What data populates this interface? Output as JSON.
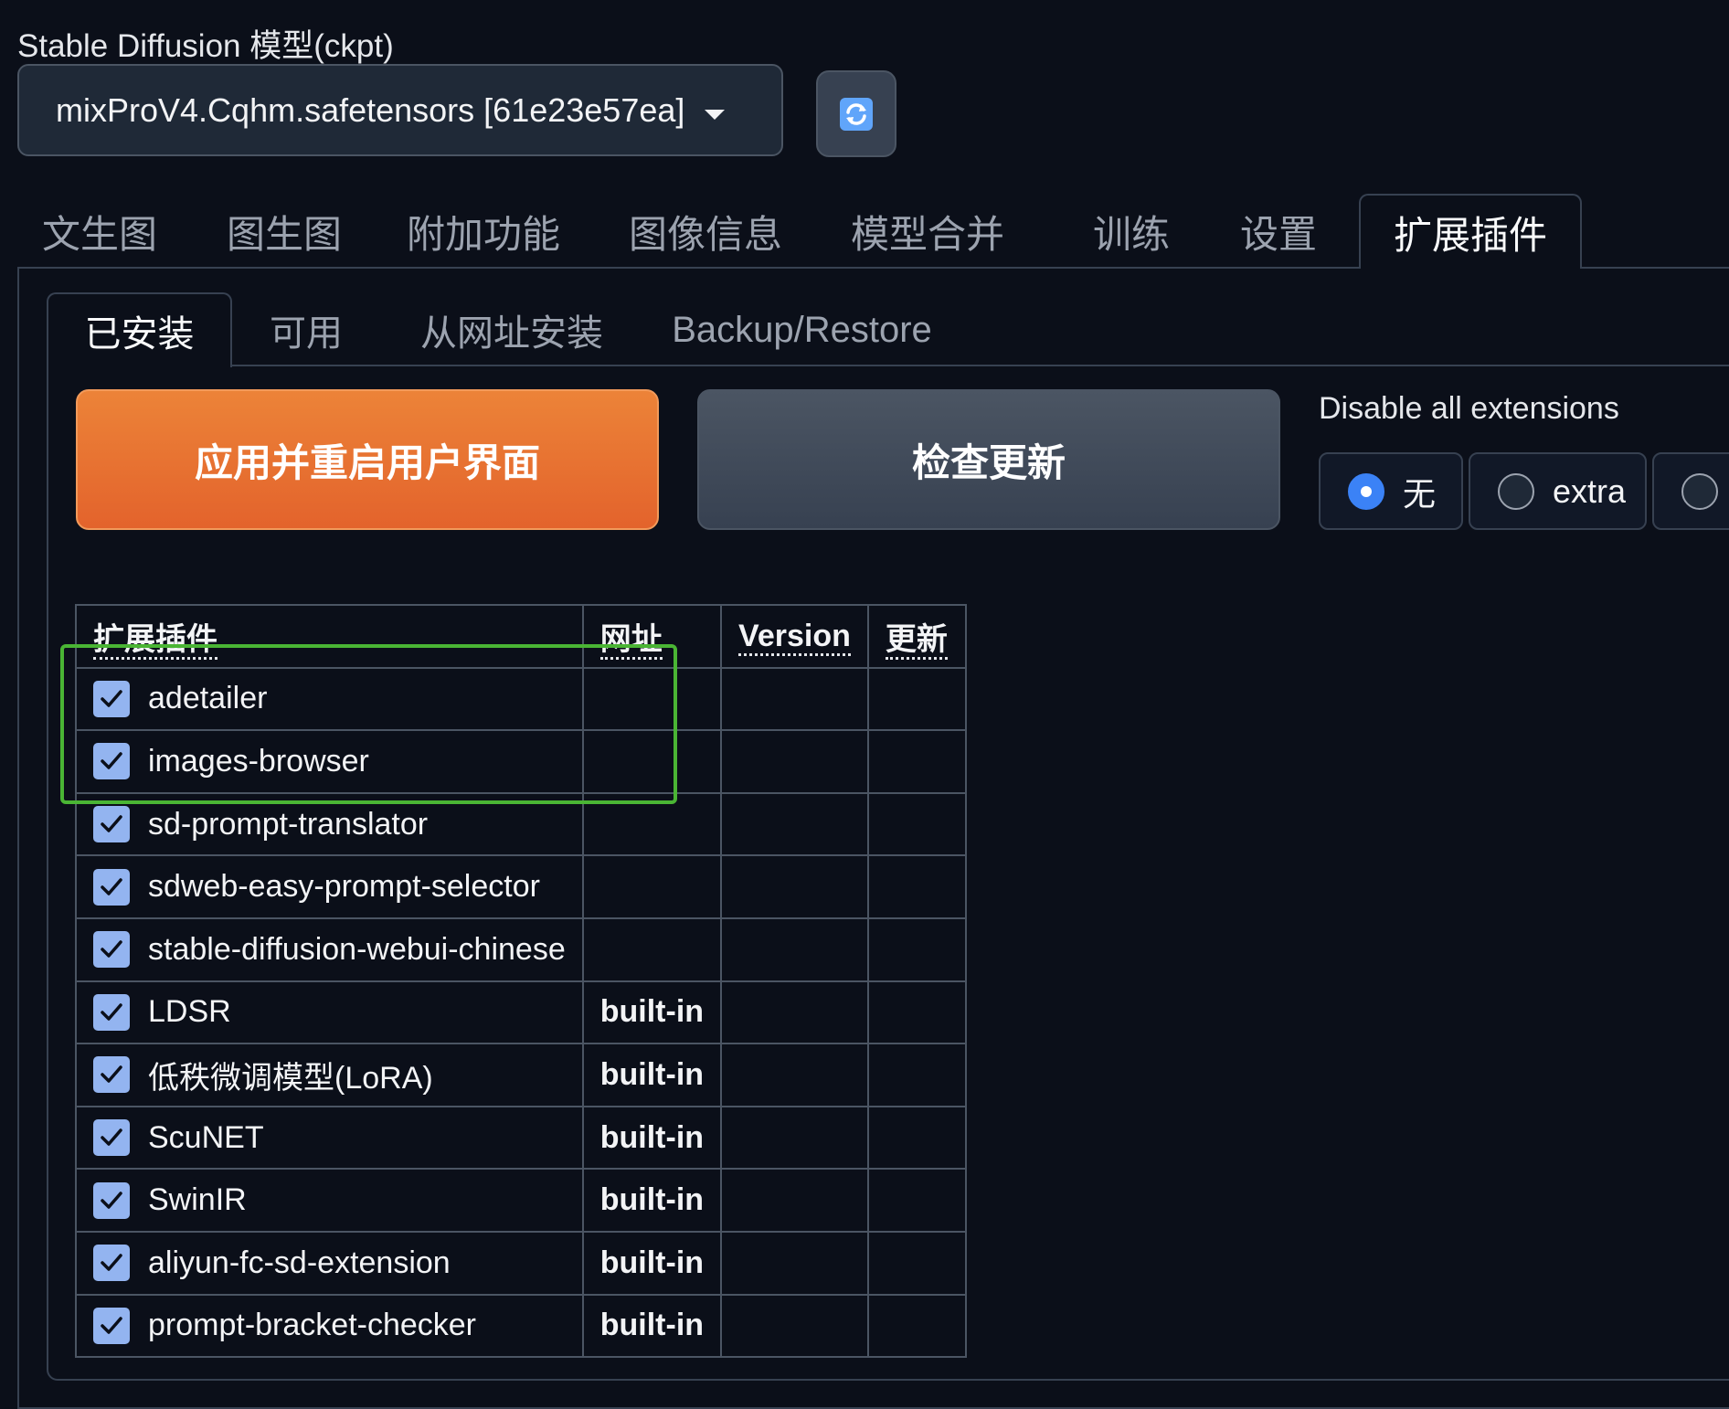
{
  "model": {
    "label": "Stable Diffusion 模型(ckpt)",
    "value": "mixProV4.Cqhm.safetensors [61e23e57ea]"
  },
  "main_tabs": [
    {
      "label": "文生图"
    },
    {
      "label": "图生图"
    },
    {
      "label": "附加功能"
    },
    {
      "label": "图像信息"
    },
    {
      "label": "模型合并"
    },
    {
      "label": "训练"
    },
    {
      "label": "设置"
    },
    {
      "label": "扩展插件",
      "active": true
    }
  ],
  "sub_tabs": [
    {
      "label": "已安装",
      "active": true
    },
    {
      "label": "可用"
    },
    {
      "label": "从网址安装"
    },
    {
      "label": "Backup/Restore"
    }
  ],
  "buttons": {
    "apply": "应用并重启用户界面",
    "check": "检查更新"
  },
  "disable": {
    "label": "Disable all extensions",
    "options": [
      {
        "label": "无",
        "checked": true
      },
      {
        "label": "extra",
        "checked": false
      },
      {
        "label": "",
        "checked": false
      }
    ]
  },
  "table": {
    "headers": [
      "扩展插件",
      "网址",
      "Version",
      "更新"
    ],
    "rows": [
      {
        "name": "adetailer",
        "url": "",
        "version": "",
        "update": "",
        "enabled": true
      },
      {
        "name": "images-browser",
        "url": "",
        "version": "",
        "update": "",
        "enabled": true
      },
      {
        "name": "sd-prompt-translator",
        "url": "",
        "version": "",
        "update": "",
        "enabled": true
      },
      {
        "name": "sdweb-easy-prompt-selector",
        "url": "",
        "version": "",
        "update": "",
        "enabled": true
      },
      {
        "name": "stable-diffusion-webui-chinese",
        "url": "",
        "version": "",
        "update": "",
        "enabled": true
      },
      {
        "name": "LDSR",
        "url": "built-in",
        "version": "",
        "update": "",
        "enabled": true
      },
      {
        "name": "低秩微调模型(LoRA)",
        "url": "built-in",
        "version": "",
        "update": "",
        "enabled": true
      },
      {
        "name": "ScuNET",
        "url": "built-in",
        "version": "",
        "update": "",
        "enabled": true
      },
      {
        "name": "SwinIR",
        "url": "built-in",
        "version": "",
        "update": "",
        "enabled": true
      },
      {
        "name": "aliyun-fc-sd-extension",
        "url": "built-in",
        "version": "",
        "update": "",
        "enabled": true
      },
      {
        "name": "prompt-bracket-checker",
        "url": "built-in",
        "version": "",
        "update": "",
        "enabled": true
      }
    ]
  },
  "colors": {
    "background": "#0b0f19",
    "accent_orange": "#e8743a",
    "highlight_green": "#4ab534",
    "checkbox": "#93b4f0",
    "radio_selected": "#3b82f6"
  }
}
